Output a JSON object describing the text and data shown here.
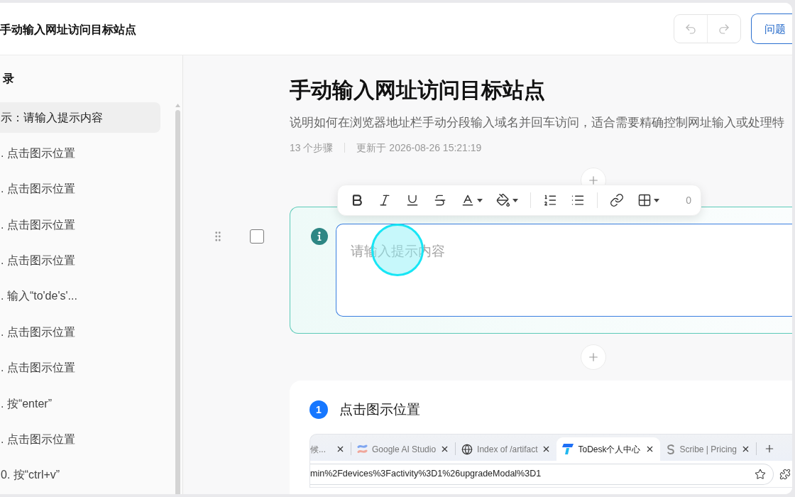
{
  "header": {
    "title": "手动输入网址访问目标站点",
    "history": [
      {
        "kind": "undo",
        "disabled": true
      },
      {
        "kind": "redo",
        "disabled": true
      }
    ],
    "feedback": "问题"
  },
  "sidebar": {
    "heading": "录",
    "items": [
      {
        "label": "示：请输入提示内容",
        "selected": true
      },
      {
        "label": ". 点击图示位置",
        "selected": false
      },
      {
        "label": ". 点击图示位置",
        "selected": false
      },
      {
        "label": ". 点击图示位置",
        "selected": false
      },
      {
        "label": ". 点击图示位置",
        "selected": false
      },
      {
        "label": ". 输入“to'de's'...",
        "selected": false
      },
      {
        "label": ". 点击图示位置",
        "selected": false
      },
      {
        "label": ". 点击图示位置",
        "selected": false
      },
      {
        "label": ". 按“enter”",
        "selected": false
      },
      {
        "label": ". 点击图示位置",
        "selected": false
      },
      {
        "label": "0. 按“ctrl+v”",
        "selected": false
      }
    ]
  },
  "article": {
    "title": "手动输入网址访问目标站点",
    "description": "说明如何在浏览器地址栏手动分段输入域名并回车访问，适合需要精确控制网址输入或处理特",
    "step_count": "13 个步骤",
    "updated": "更新于 2026-08-26 15:21:19"
  },
  "toolbar": {
    "groups": [
      {
        "items": [
          {
            "kind": "bold",
            "dropdown": false
          },
          {
            "kind": "italic",
            "dropdown": false
          },
          {
            "kind": "underline",
            "dropdown": false
          },
          {
            "kind": "strikethrough",
            "dropdown": false
          },
          {
            "kind": "text_color",
            "dropdown": true
          },
          {
            "kind": "highlight",
            "dropdown": true
          }
        ]
      },
      {
        "items": [
          {
            "kind": "ordered_list",
            "dropdown": false
          },
          {
            "kind": "bullet_list",
            "dropdown": false
          }
        ]
      },
      {
        "items": [
          {
            "kind": "link",
            "dropdown": false
          },
          {
            "kind": "table",
            "dropdown": true
          }
        ]
      }
    ],
    "count": "0"
  },
  "tip": {
    "checked": false,
    "placeholder": "请输入提示内容"
  },
  "steps": [
    {
      "number": "1",
      "title": "点击图示位置",
      "screenshot": {
        "tabs": [
          {
            "label": "候...",
            "selected": false
          },
          {
            "label": "Google AI Studio",
            "kind": "stripes",
            "selected": false
          },
          {
            "label": "Index of /artifact",
            "kind": "globe",
            "selected": false
          },
          {
            "label": "ToDesk个人中心",
            "kind": "parallelogram",
            "selected": true
          },
          {
            "label": "Scribe | Pricing",
            "kind": "swirl",
            "selected": false
          }
        ],
        "address": "min%2Fdevices%3Factivity%3D1%26upgradeModal%3D1"
      }
    }
  ]
}
